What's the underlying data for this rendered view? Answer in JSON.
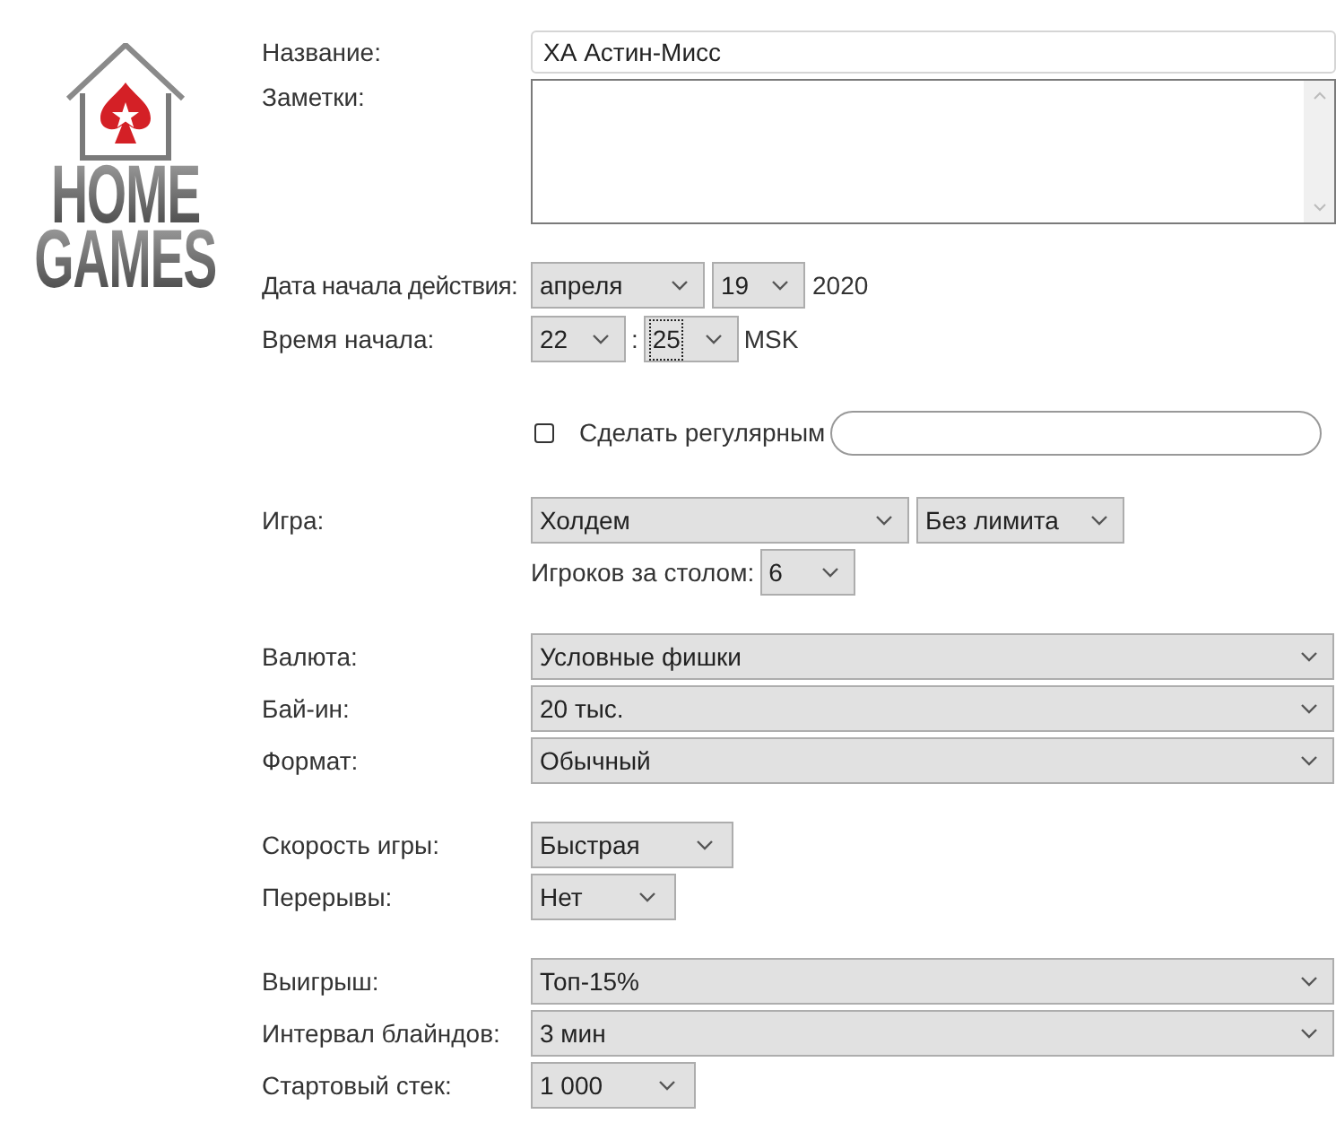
{
  "logo": {
    "lines": [
      "HOME",
      "GAMES"
    ]
  },
  "name_field": {
    "label": "Название:",
    "value": "ХА Астин-Мисс"
  },
  "notes_field": {
    "label": "Заметки:"
  },
  "start_date": {
    "label": "Дата начала действия:",
    "month": "апреля",
    "day": "19",
    "year": "2020"
  },
  "start_time": {
    "label": "Время начала:",
    "hour": "22",
    "separator": ":",
    "minute": "25",
    "minute_focused": true,
    "timezone": "MSK"
  },
  "recurring": {
    "label": "Сделать регулярным",
    "checked": false
  },
  "game": {
    "label": "Игра:",
    "type": "Холдем",
    "limit": "Без лимита",
    "players_label": "Игроков за столом:",
    "players": "6"
  },
  "settings": [
    [
      {
        "label": "Валюта:",
        "value": "Условные фишки",
        "kind": "full"
      },
      {
        "label": "Бай-ин:",
        "value": "20 тыс.",
        "kind": "full"
      },
      {
        "label": "Формат:",
        "value": "Обычный",
        "kind": "full"
      }
    ],
    [
      {
        "label": "Скорость игры:",
        "value": "Быстрая",
        "kind": "compact"
      },
      {
        "label": "Перерывы:",
        "value": "Нет",
        "kind": "compact"
      }
    ],
    [
      {
        "label": "Выигрыш:",
        "value": "Топ-15%",
        "kind": "full"
      },
      {
        "label": "Интервал блайндов:",
        "value": "3 мин",
        "kind": "full"
      },
      {
        "label": "Стартовый стек:",
        "value": "1 000",
        "kind": "compact"
      }
    ]
  ]
}
